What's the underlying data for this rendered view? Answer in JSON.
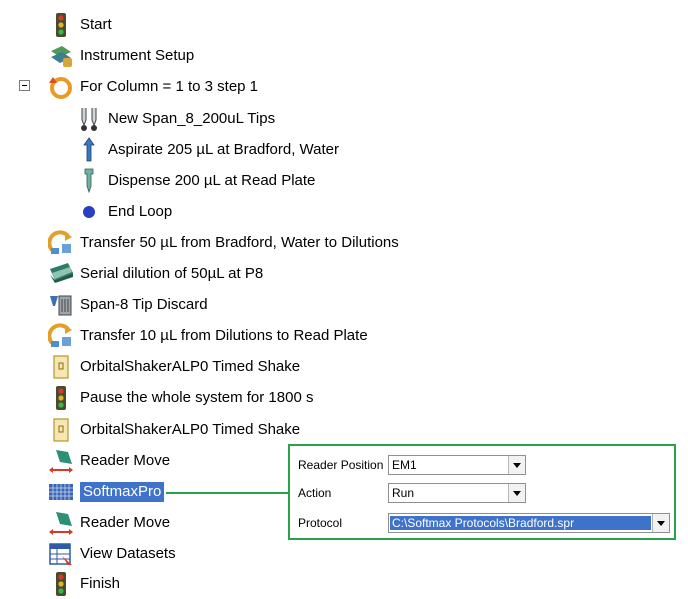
{
  "tree": {
    "items": [
      {
        "label": "Start",
        "icon": "traffic-light-start-icon"
      },
      {
        "label": "Instrument Setup",
        "icon": "instrument-setup-icon"
      },
      {
        "label": "For Column = 1 to 3 step 1",
        "icon": "loop-icon"
      },
      {
        "label": "New Span_8_200uL Tips",
        "icon": "tips-icon"
      },
      {
        "label": "Aspirate 205 µL at Bradford, Water",
        "icon": "aspirate-pipette-icon"
      },
      {
        "label": "Dispense 200 µL at Read Plate",
        "icon": "dispense-pipette-icon"
      },
      {
        "label": "End Loop",
        "icon": "end-loop-dot-icon"
      },
      {
        "label": "Transfer 50 µL from Bradford, Water to Dilutions",
        "icon": "transfer-icon"
      },
      {
        "label": "Serial dilution of 50µL at P8",
        "icon": "serial-dilution-icon"
      },
      {
        "label": "Span-8 Tip Discard",
        "icon": "tip-discard-icon"
      },
      {
        "label": "Transfer 10 µL from Dilutions to Read Plate",
        "icon": "transfer-icon"
      },
      {
        "label": "OrbitalShakerALP0 Timed Shake",
        "icon": "shaker-icon"
      },
      {
        "label": "Pause the whole system for 1800 s",
        "icon": "traffic-light-pause-icon"
      },
      {
        "label": "OrbitalShakerALP0 Timed Shake",
        "icon": "shaker-icon"
      },
      {
        "label": "Reader Move",
        "icon": "reader-move-icon"
      },
      {
        "label": "SoftmaxPro",
        "icon": "softmaxpro-grid-icon",
        "selected": true
      },
      {
        "label": "Reader Move",
        "icon": "reader-move-icon"
      },
      {
        "label": "View Datasets",
        "icon": "view-datasets-icon"
      },
      {
        "label": "Finish",
        "icon": "traffic-light-finish-icon"
      }
    ]
  },
  "properties": {
    "reader_position": {
      "label": "Reader Position",
      "value": "EM1"
    },
    "action": {
      "label": "Action",
      "value": "Run"
    },
    "protocol": {
      "label": "Protocol",
      "value": "C:\\Softmax Protocols\\Bradford.spr"
    }
  },
  "colors": {
    "accent_green": "#2aa24a",
    "selection_blue": "#3f72c9"
  }
}
